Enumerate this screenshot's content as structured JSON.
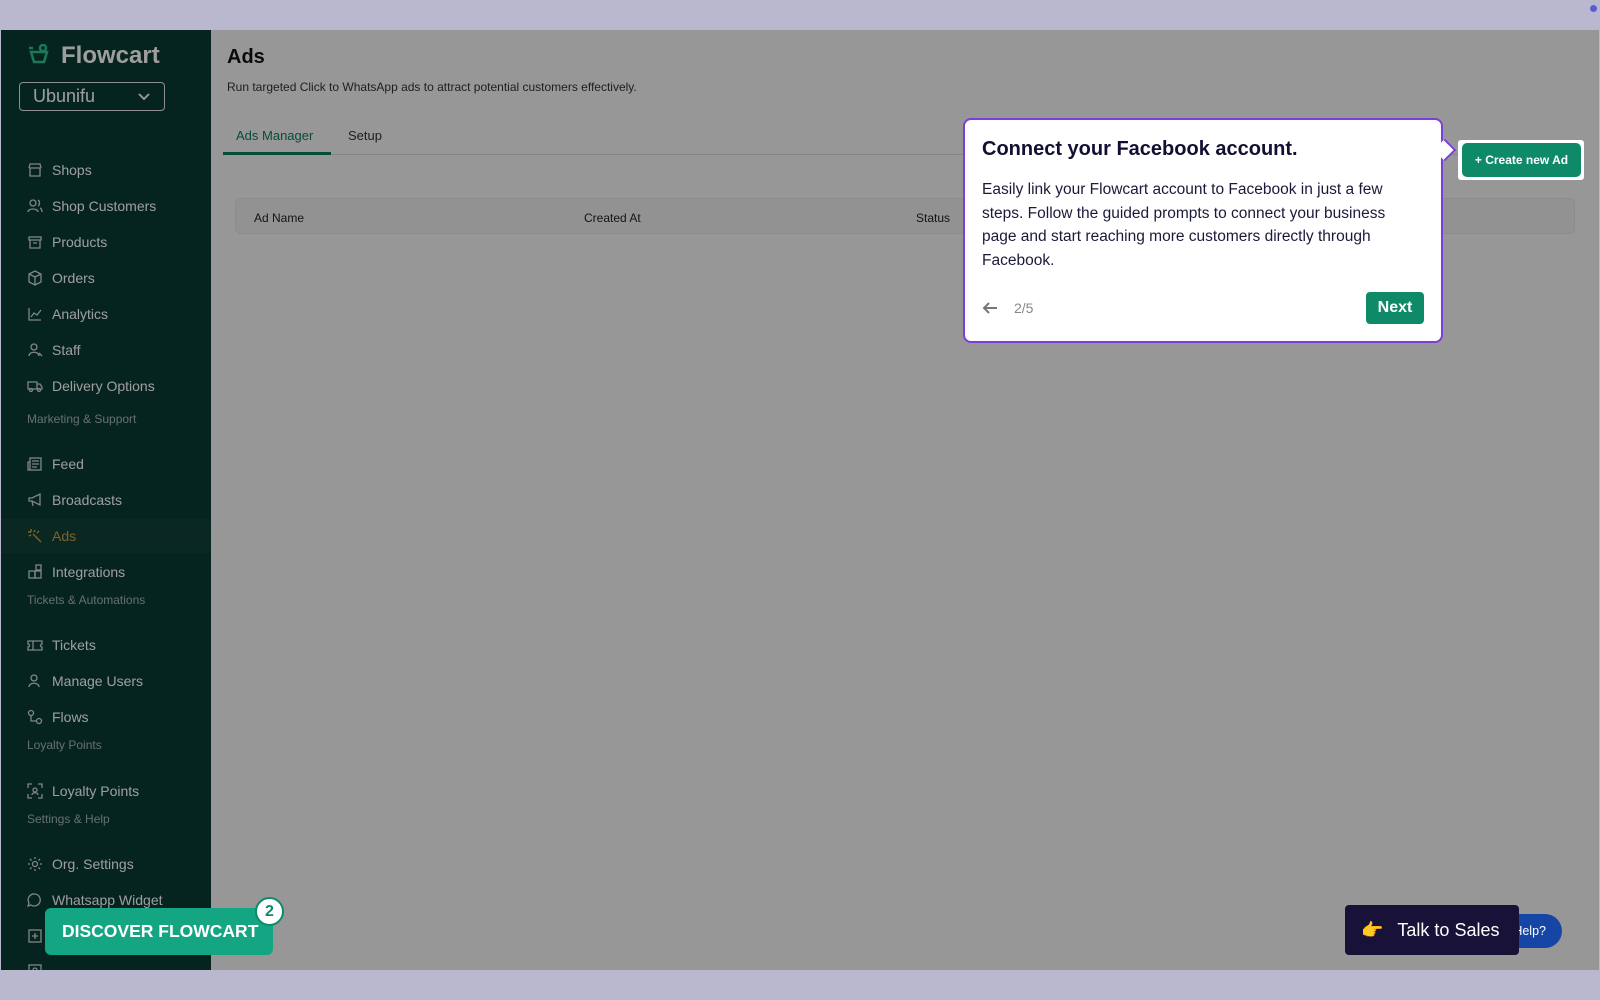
{
  "sidebar": {
    "brand": "Flowcart",
    "org": "Ubunifu",
    "items": [
      {
        "label": "Shops",
        "icon": "store-icon"
      },
      {
        "label": "Shop Customers",
        "icon": "users-icon"
      },
      {
        "label": "Products",
        "icon": "box-icon"
      },
      {
        "label": "Orders",
        "icon": "package-icon"
      },
      {
        "label": "Analytics",
        "icon": "chart-icon"
      },
      {
        "label": "Staff",
        "icon": "user-icon"
      },
      {
        "label": "Delivery Options",
        "icon": "truck-icon"
      },
      {
        "label": "Feed",
        "icon": "news-icon"
      },
      {
        "label": "Broadcasts",
        "icon": "megaphone-icon"
      },
      {
        "label": "Ads",
        "icon": "sparkle-icon"
      },
      {
        "label": "Integrations",
        "icon": "puzzle-icon"
      },
      {
        "label": "Tickets",
        "icon": "ticket-icon"
      },
      {
        "label": "Manage Users",
        "icon": "user-icon"
      },
      {
        "label": "Flows",
        "icon": "flow-icon"
      },
      {
        "label": "Loyalty Points",
        "icon": "scan-icon"
      },
      {
        "label": "Org. Settings",
        "icon": "gear-icon"
      },
      {
        "label": "Whatsapp Widget",
        "icon": "chat-icon"
      }
    ],
    "sections": [
      "Marketing & Support",
      "Tickets & Automations",
      "Loyalty Points",
      "Settings & Help"
    ]
  },
  "main": {
    "title": "Ads",
    "subtitle": "Run targeted Click to WhatsApp ads to attract potential customers effectively.",
    "tabs": [
      "Ads Manager",
      "Setup"
    ],
    "create_label": "+ Create new Ad",
    "columns": [
      "Ad Name",
      "Created At",
      "Status"
    ]
  },
  "tour": {
    "title": "Connect your Facebook account.",
    "body": "Easily link your Flowcart account to Facebook in just a few steps. Follow the guided prompts to connect your business page and start reaching more customers directly through Facebook.",
    "step": "2/5",
    "next_label": "Next"
  },
  "floating": {
    "discover_label": "DISCOVER FLOWCART",
    "discover_badge": "2",
    "help_label": "Help?",
    "talk_label": "Talk to Sales",
    "talk_emoji": "👉"
  },
  "colors": {
    "brand": "#0f8a68",
    "sidebar_bg": "#0a3b33",
    "active_text": "#c9a24a",
    "tour_border": "#7a3fd6"
  }
}
